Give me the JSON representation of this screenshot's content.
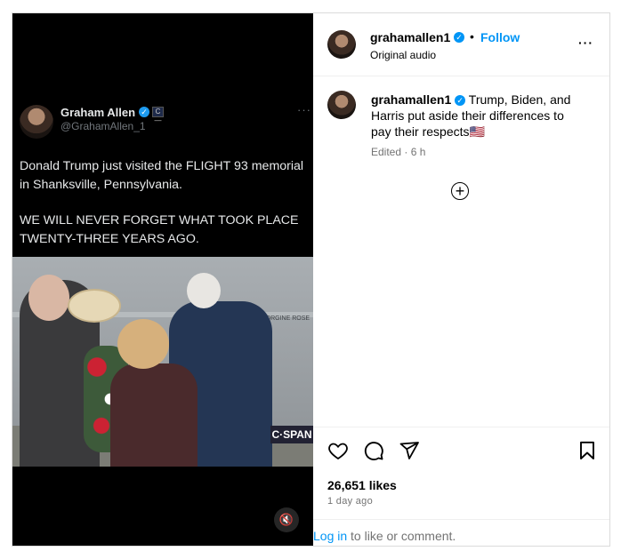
{
  "tweet": {
    "name": "Graham Allen",
    "handle": "@GrahamAllen_1",
    "more": "···",
    "verified_glyph": "✓",
    "badge_glyph": "C—",
    "text_p1": "Donald Trump just visited the FLIGHT 93 memorial in Shanksville, Pennsylvania.",
    "text_p2": "WE WILL NEVER FORGET WHAT TOOK PLACE TWENTY-THREE YEARS AGO."
  },
  "photo": {
    "wall_text": "EORGINE ROSE",
    "watermark": "C·SPAN"
  },
  "media": {
    "mute_icon": "muted-speaker-icon",
    "mute_glyph": "🔇"
  },
  "post": {
    "username": "grahamallen1",
    "verified_glyph": "✓",
    "dot": "•",
    "follow_label": "Follow",
    "audio": "Original audio",
    "more": "···",
    "caption_username": "grahamallen1",
    "caption_text": " Trump, Biden, and Harris put aside their differences to pay their respects🇺🇸",
    "meta": "Edited · 6 h",
    "plus_glyph": "+",
    "likes": "26,651 likes",
    "ago": "1 day ago",
    "login_link": "Log in",
    "login_rest": " to like or comment."
  },
  "colors": {
    "accent": "#0095f6",
    "muted": "#737373",
    "border": "#dbdbdb"
  }
}
